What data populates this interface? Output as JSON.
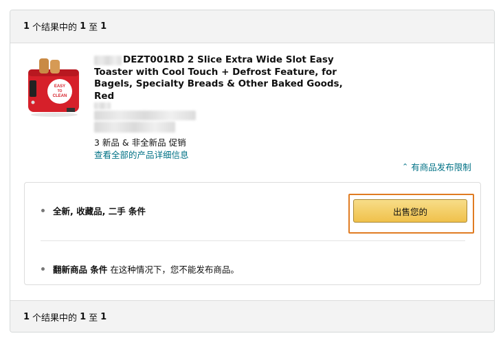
{
  "results_bar": {
    "count": "1",
    "of_text": "个结果中的",
    "range_start": "1",
    "to_text": "至",
    "range_end": "1"
  },
  "product": {
    "title": "DEZT001RD 2 Slice Extra Wide Slot Easy Toaster with Cool Touch + Defrost Feature, for Bagels, Specialty Breads & Other Baked Goods, Red",
    "offers_text": "3 新品 & 非全新品 促销",
    "details_link": "查看全部的产品详细信息",
    "image_badge": "EASY TO CLEAN"
  },
  "restriction": {
    "label": "有商品发布限制",
    "icon": "chevron-up-icon"
  },
  "conditions": {
    "row1_label": "全新, 收藏品, 二手 条件",
    "sell_button": "出售您的",
    "row2_label": "翻新商品 条件",
    "row2_note": "在这种情况下，您不能发布商品。"
  },
  "colors": {
    "link": "#007185",
    "highlight": "#e07b21",
    "button": "#f0c14b",
    "toaster": "#d6202a"
  }
}
